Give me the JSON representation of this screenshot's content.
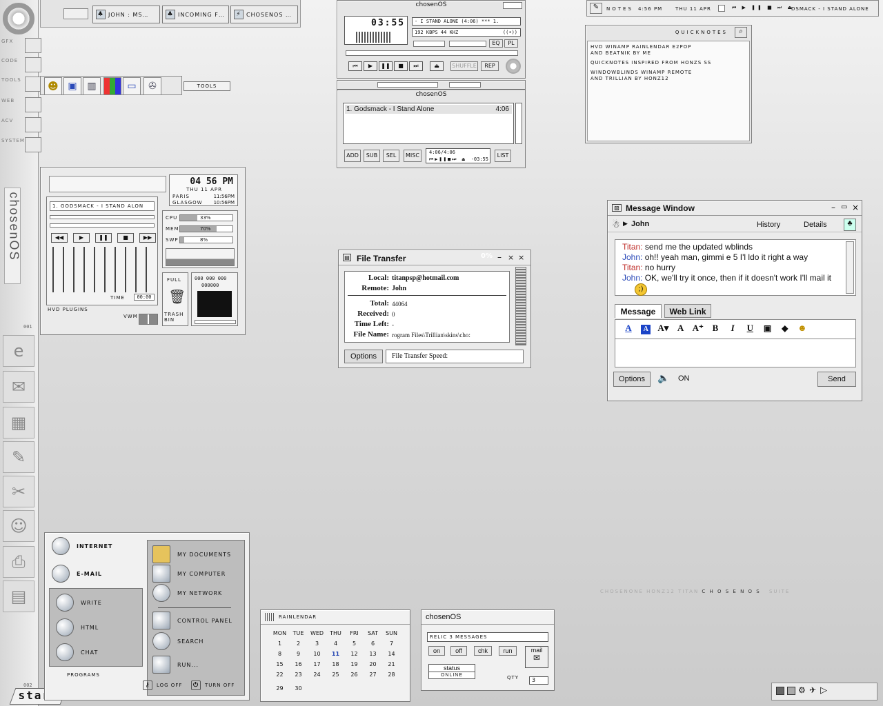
{
  "left_rail": {
    "labels": [
      "GFX",
      "CODE",
      "TOOLS",
      "WEB",
      "ACV",
      "SYSTEM"
    ],
    "brand": "chosenOS",
    "num_top": "001",
    "num_bottom": "002",
    "start_label": "start"
  },
  "taskbar": {
    "items": [
      "JOHN : MS…",
      "INCOMING F…",
      "CHOSENOS …"
    ]
  },
  "tools_bar": {
    "label": "TOOLS"
  },
  "notes_bar": {
    "notes_label": "NOTES",
    "time": "4:56 PM",
    "date": "THU 11 APR",
    "track": "DSMACK - I STAND ALONE"
  },
  "quicknotes": {
    "title": "QUICKNOTES",
    "lines": [
      "HVD WINAMP RAINLENDAR E2POP",
      "AND BEATNIK BY ME",
      "QUICKNOTES INSPIRED FROM HONZS SS",
      "WINDOWBLINDS WINAMP REMOTE",
      "AND TRILLIAN BY HONZ12"
    ]
  },
  "winamp": {
    "title": "chosenOS",
    "time": "03:55",
    "song": "- I STAND ALONE (4:06) *** 1.",
    "info": "192 KBPS  44 KHZ",
    "mode": "((•))",
    "eq": "EQ",
    "pl": "PL",
    "shuffle": "SHUFFLE",
    "rep": "REP",
    "pl_title": "chosenOS",
    "pl_item": "1. Godsmack - I Stand Alone",
    "pl_item_time": "4:06",
    "pl_buttons": [
      "ADD",
      "SUB",
      "SEL",
      "MISC"
    ],
    "pl_time": "4:06/4:06",
    "pl_rem": "-03:55",
    "list": "LIST"
  },
  "hvd": {
    "clock": "04 56 PM",
    "date": "THU 11 APR",
    "city1": "PARIS",
    "city1_time": "11:56PM",
    "city2": "GLASGOW",
    "city2_time": "10:56PM",
    "song": "1. GODSMACK - I STAND ALON",
    "cpu_label": "CPU",
    "cpu": "33%",
    "cpu_val": 0.33,
    "mem_label": "MEM",
    "mem": "70%",
    "mem_val": 0.7,
    "swp_label": "SWP",
    "swp": "8%",
    "swp_val": 0.08,
    "time_label": "TIME",
    "time": "00:00",
    "plugins": "HVD PLUGINS",
    "full": "FULL",
    "trash": "TRASH BIN",
    "digits1": "000 000 000",
    "digits2": "000000",
    "vwm": "VWM"
  },
  "file_transfer": {
    "title": "File Transfer",
    "percent": "0%",
    "local_label": "Local:",
    "local": "titanpsp@hotmail.com",
    "remote_label": "Remote:",
    "remote": "John",
    "total_label": "Total:",
    "total": "44064",
    "received_label": "Received:",
    "received": "0",
    "left_label": "Time Left:",
    "left": "-",
    "file_label": "File Name:",
    "file": "rogram Files\\Trillian\\skins\\cho:",
    "options": "Options",
    "speed": "File Transfer Speed:"
  },
  "messenger": {
    "title": "Message Window",
    "contact": "John",
    "history": "History",
    "details": "Details",
    "lines": [
      {
        "name": "Titan:",
        "text": "send me the updated wblinds",
        "who": "t"
      },
      {
        "name": "John:",
        "text": "oh!! yeah man, gimmi e 5 I'l ldo it right a way",
        "who": "j"
      },
      {
        "name": "Titan:",
        "text": "no hurry",
        "who": "t"
      },
      {
        "name": "John:",
        "text": "OK, we'll try it once, then if it doesn't work I'll mail it",
        "who": "j"
      }
    ],
    "tab_message": "Message",
    "tab_weblink": "Web Link",
    "options": "Options",
    "sound": "ON",
    "send": "Send"
  },
  "start_menu": {
    "internet": "INTERNET",
    "email": "E-MAIL",
    "left": [
      "WRITE",
      "HTML",
      "CHAT"
    ],
    "programs": "PROGRAMS",
    "right": [
      "MY DOCUMENTS",
      "MY COMPUTER",
      "MY NETWORK",
      "CONTROL PANEL",
      "SEARCH",
      "RUN..."
    ],
    "logoff": "LOG OFF",
    "turnoff": "TURN OFF"
  },
  "rainlendar": {
    "title": "RAINLENDAR",
    "days": [
      "MON",
      "TUE",
      "WED",
      "THU",
      "FRI",
      "SAT",
      "SUN"
    ],
    "weeks": [
      [
        "1",
        "2",
        "3",
        "4",
        "5",
        "6",
        "7"
      ],
      [
        "8",
        "9",
        "10",
        "11",
        "12",
        "13",
        "14"
      ],
      [
        "15",
        "16",
        "17",
        "18",
        "19",
        "20",
        "21"
      ],
      [
        "22",
        "23",
        "24",
        "25",
        "26",
        "27",
        "28"
      ],
      [
        "29",
        "30",
        "",
        "",
        "",
        "",
        ""
      ]
    ],
    "today": "11"
  },
  "relic": {
    "title": "chosenOS",
    "messages": "RELIC 3 MESSAGES",
    "buttons": [
      "on",
      "off",
      "chk",
      "run"
    ],
    "mail": "mail",
    "status_label": "status",
    "status": "ONLINE",
    "qty_label": "QTY",
    "qty": "3"
  },
  "credits": {
    "text": "CHOSENONE  HONZ12  TITAN  ",
    "brand": "C H O S E N O S",
    "suite": "SUITE"
  }
}
